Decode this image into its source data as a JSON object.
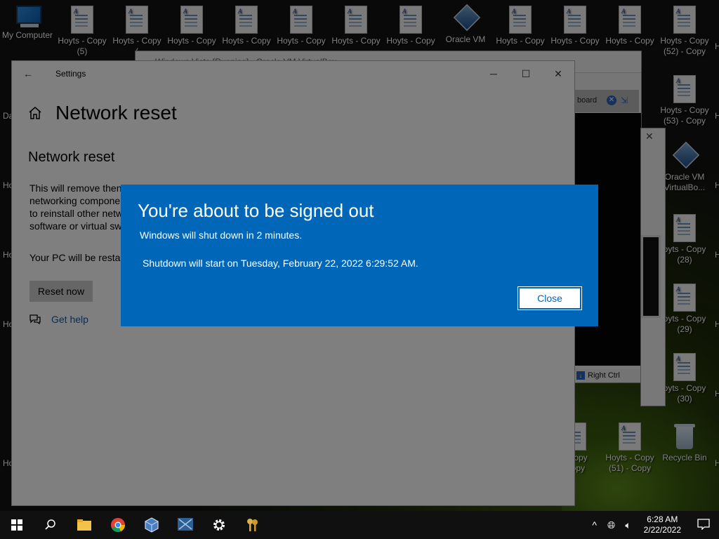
{
  "desktop": {
    "icons": [
      {
        "label_line1": "My Computer",
        "label_line2": ""
      },
      {
        "label_line1": "Hoyts - Copy",
        "label_line2": "(5)"
      },
      {
        "label_line1": "Hoyts - Copy",
        "label_line2": "("
      },
      {
        "label_line1": "Hoyts - Copy",
        "label_line2": ""
      },
      {
        "label_line1": "Hoyts - Copy",
        "label_line2": ""
      },
      {
        "label_line1": "Hoyts - Copy",
        "label_line2": ""
      },
      {
        "label_line1": "Hoyts - Copy",
        "label_line2": ""
      },
      {
        "label_line1": "Hoyts - Copy",
        "label_line2": ""
      },
      {
        "label_line1": "Oracle VM",
        "label_line2": ""
      },
      {
        "label_line1": "Hoyts - Copy",
        "label_line2": ""
      },
      {
        "label_line1": "Hoyts - Copy",
        "label_line2": ""
      },
      {
        "label_line1": "Hoyts - Copy",
        "label_line2": ""
      },
      {
        "label_line1": "Hoyts - Copy",
        "label_line2": "(52) - Copy"
      },
      {
        "label_line1": "Hoyts - Copy",
        "label_line2": "(53) - Copy"
      },
      {
        "label_line1": "Oracle VM",
        "label_line2": "VirtualBo..."
      },
      {
        "label_line1": "oyts - Copy",
        "label_line2": "(28)"
      },
      {
        "label_line1": "oyts - Copy",
        "label_line2": "(29)"
      },
      {
        "label_line1": "oyts - Copy",
        "label_line2": "(30)"
      },
      {
        "label_line1": "- Copy",
        "label_line2": "Copy"
      },
      {
        "label_line1": "Hoyts - Copy",
        "label_line2": "(51) - Copy"
      },
      {
        "label_line1": "Recycle Bin",
        "label_line2": ""
      }
    ],
    "edge_labels": [
      "Da",
      "Ho",
      "Ho",
      "Ho",
      "Ho"
    ],
    "right_edge_labels": [
      "H",
      "H",
      "H",
      "H",
      "H",
      "H",
      "H"
    ]
  },
  "vbox_window": {
    "title": "Windows Vista [Running] - Oracle VM VirtualBox",
    "inner_text": "board",
    "status_text": "Right Ctrl"
  },
  "settings": {
    "window_title": "Settings",
    "back_glyph": "←",
    "minimize_glyph": "─",
    "maximize_glyph": "☐",
    "close_glyph": "✕",
    "page_title": "Network reset",
    "section_title": "Network reset",
    "description_lines": [
      "This will remove then",
      "networking compone",
      "to reinstall other netw",
      "software or virtual sw"
    ],
    "restart_note": "Your PC will be restar",
    "reset_button": "Reset now",
    "help_link": "Get help"
  },
  "signout_dialog": {
    "title": "You're about to be signed out",
    "message": "Windows will shut down in 2 minutes.",
    "detail": "Shutdown will start on Tuesday, February 22, 2022 6:29:52 AM.",
    "close_button": "Close"
  },
  "taskbar": {
    "apps": [
      "start-icon",
      "search-icon",
      "file-explorer-icon",
      "chrome-icon",
      "virtualbox-icon",
      "vista-vm-icon",
      "settings-icon",
      "keys-icon"
    ],
    "tray_chevron": "^",
    "clock_time": "6:28 AM",
    "clock_date": "2/22/2022"
  },
  "colors": {
    "dialog_blue": "#0067b8",
    "link_blue": "#0a5bb5",
    "taskbar": "#101010"
  }
}
